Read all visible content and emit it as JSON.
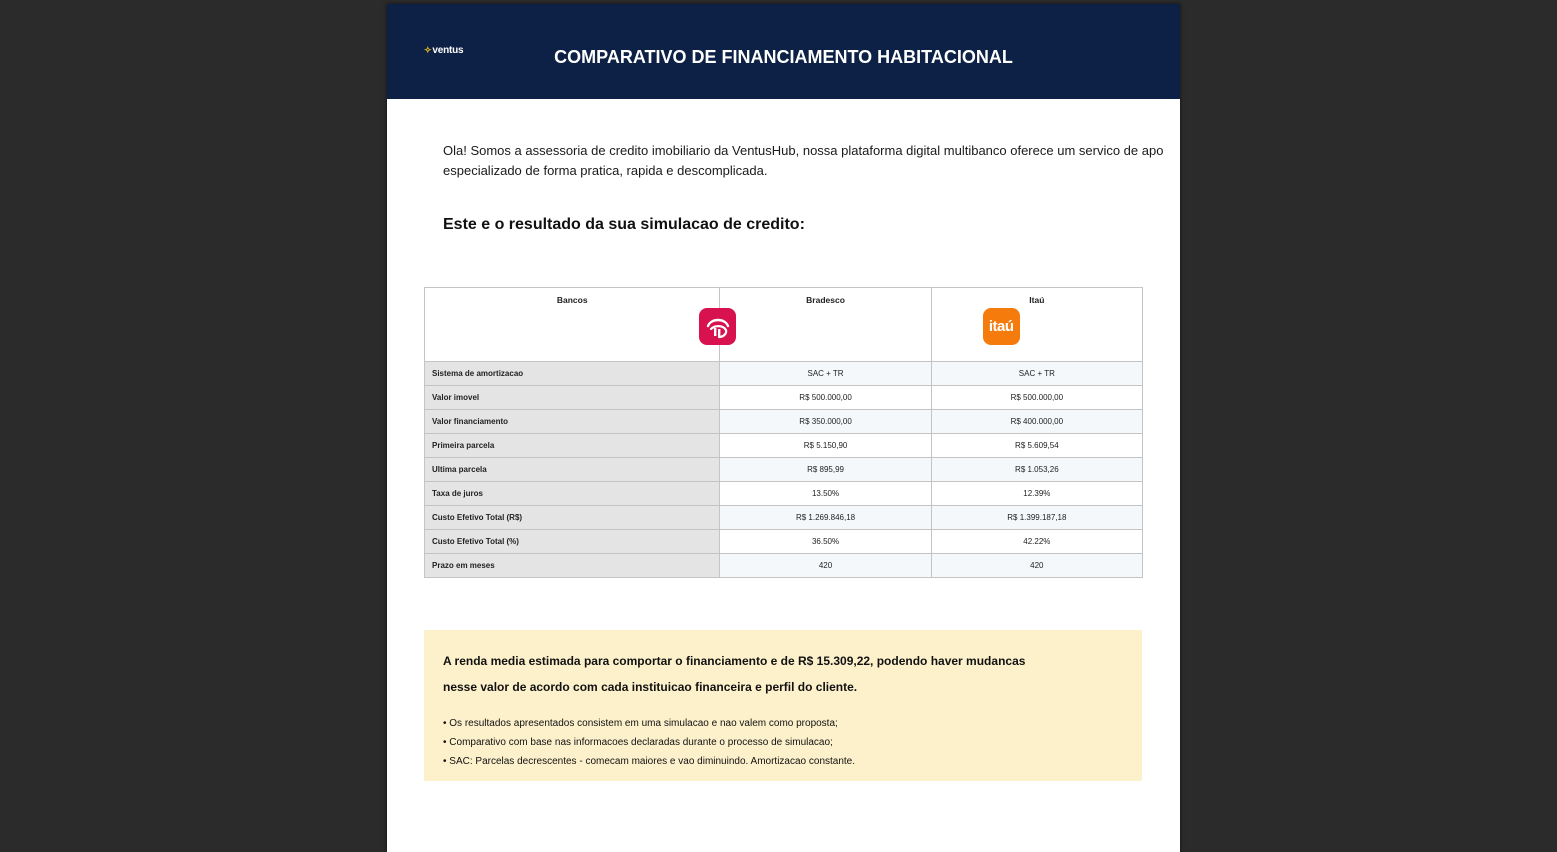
{
  "header": {
    "logo_text": "ventus",
    "title": "COMPARATIVO DE FINANCIAMENTO HABITACIONAL"
  },
  "intro": {
    "line1": "Ola! Somos a assessoria de credito imobiliario da VentusHub, nossa plataforma digital multibanco oferece um servico de apo",
    "line2": "especializado de forma pratica, rapida e descomplicada."
  },
  "result_heading": "Este e o resultado da sua simulacao de credito:",
  "table": {
    "header_label": "Bancos",
    "banks": [
      {
        "name": "Bradesco",
        "color": "#d8114f"
      },
      {
        "name": "Itaú",
        "logo_text": "itaú",
        "color": "#f47b0c"
      }
    ],
    "rows": [
      {
        "label": "Sistema de amortizacao",
        "values": [
          "SAC + TR",
          "SAC + TR"
        ]
      },
      {
        "label": "Valor imovel",
        "values": [
          "R$ 500.000,00",
          "R$ 500.000,00"
        ]
      },
      {
        "label": "Valor financiamento",
        "values": [
          "R$ 350.000,00",
          "R$ 400.000,00"
        ]
      },
      {
        "label": "Primeira parcela",
        "values": [
          "R$ 5.150,90",
          "R$ 5.609,54"
        ]
      },
      {
        "label": "Ultima parcela",
        "values": [
          "R$ 895,99",
          "R$ 1.053,26"
        ]
      },
      {
        "label": "Taxa de juros",
        "values": [
          "13.50%",
          "12.39%"
        ]
      },
      {
        "label": "Custo Efetivo Total (R$)",
        "values": [
          "R$ 1.269.846,18",
          "R$ 1.399.187,18"
        ]
      },
      {
        "label": "Custo Efetivo Total (%)",
        "values": [
          "36.50%",
          "42.22%"
        ]
      },
      {
        "label": "Prazo em meses",
        "values": [
          "420",
          "420"
        ]
      }
    ]
  },
  "notice": {
    "line1": "A renda media estimada para comportar o financiamento e de R$ 15.309,22, podendo haver mudancas",
    "line2": "nesse valor de acordo com cada instituicao financeira e perfil do cliente.",
    "bullets": [
      "• Os resultados apresentados consistem em uma simulacao e nao valem como proposta;",
      "• Comparativo com base nas informacoes declaradas durante o processo de simulacao;",
      "• SAC: Parcelas decrescentes - comecam maiores e vao diminuindo. Amortizacao constante."
    ]
  },
  "colors": {
    "header_bg": "#0c2145",
    "notice_bg": "#fdf1cc",
    "logo_accent": "#f5c518"
  }
}
